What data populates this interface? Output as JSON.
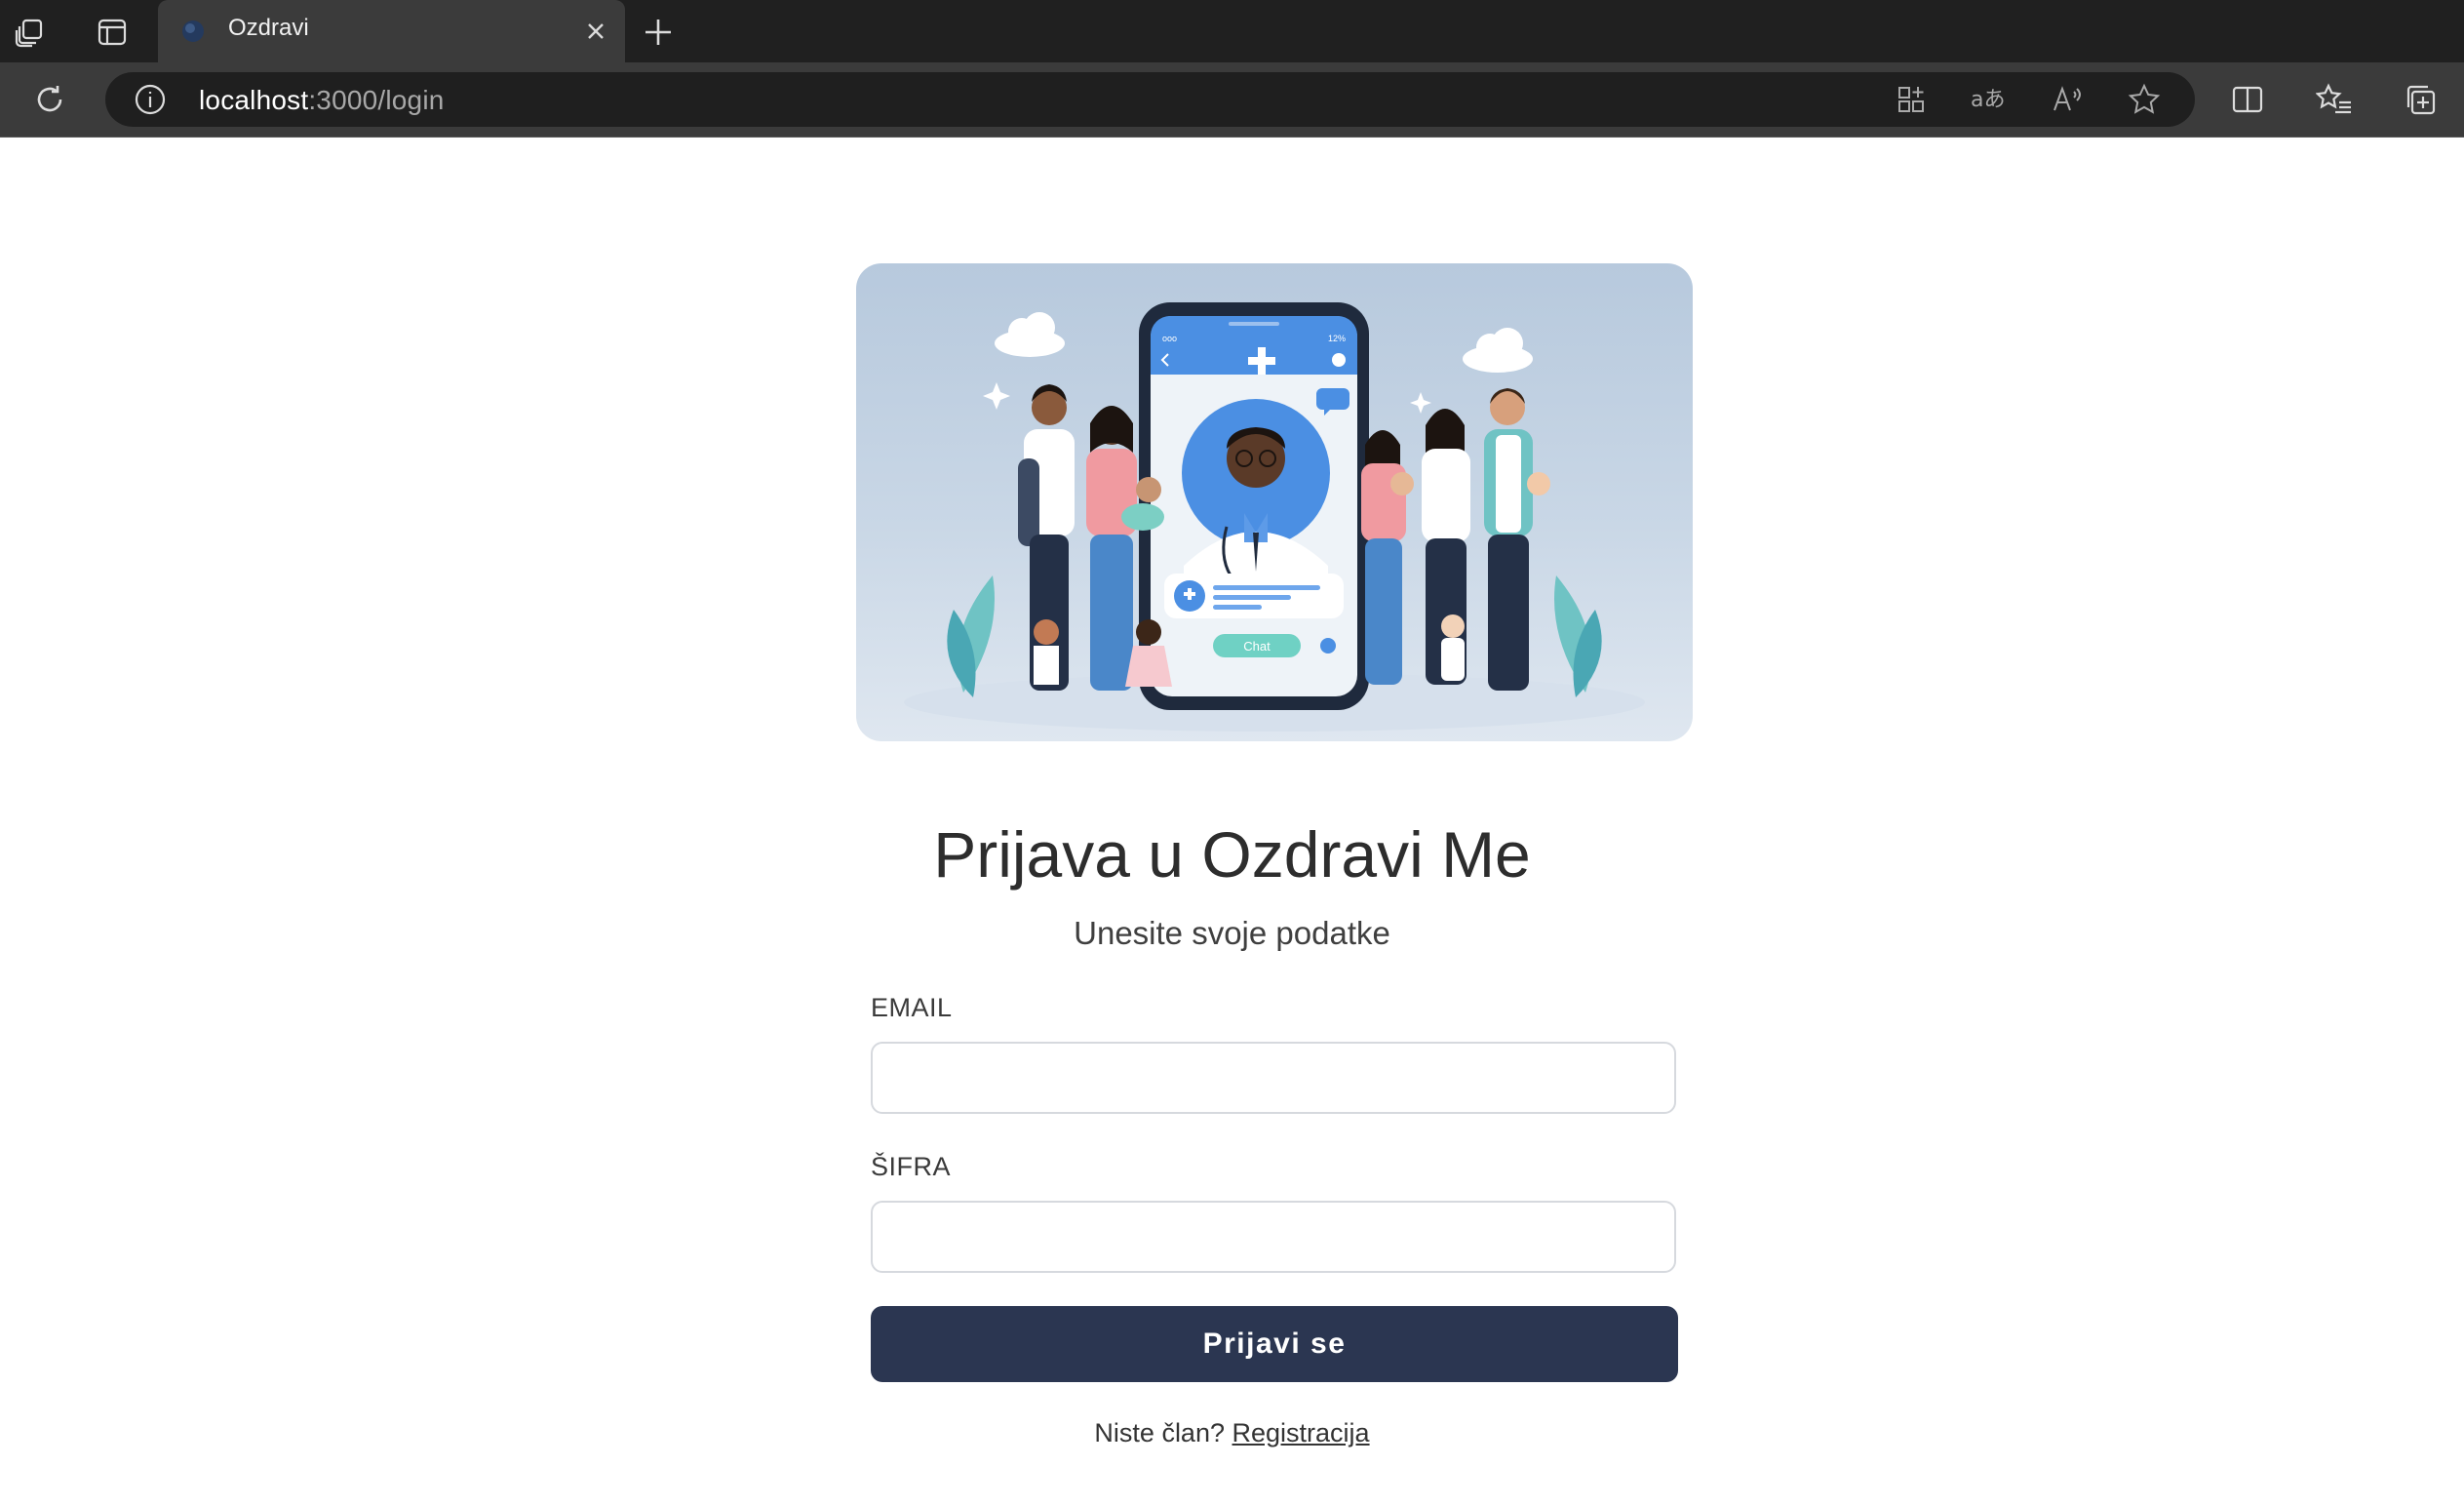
{
  "browser": {
    "tab_title": "Ozdravi",
    "url_host": "localhost",
    "url_path": ":3000/login",
    "icons": [
      "workspaces-icon",
      "tab-actions-icon",
      "favicon-icon",
      "close-tab-icon",
      "new-tab-icon",
      "refresh-icon",
      "site-info-icon",
      "app-available-icon",
      "translate-icon",
      "read-aloud-icon",
      "favorite-star-icon",
      "split-screen-icon",
      "favorites-icon",
      "collections-icon"
    ]
  },
  "hero": {
    "chat_label": "Chat",
    "status_left": "ooo",
    "status_right": "12%"
  },
  "login": {
    "title": "Prijava u Ozdravi Me",
    "subtitle": "Unesite svoje podatke",
    "email_label": "EMAIL",
    "email_value": "",
    "password_label": "ŠIFRA",
    "password_value": "",
    "submit_label": "Prijavi se",
    "footer_text": "Niste član?",
    "register_link": "Registracija"
  },
  "colors": {
    "tabbar": "#202020",
    "toolbar": "#3b3b3b",
    "primary_button": "#2b3651",
    "hero_bg": "#b7c9dd"
  }
}
